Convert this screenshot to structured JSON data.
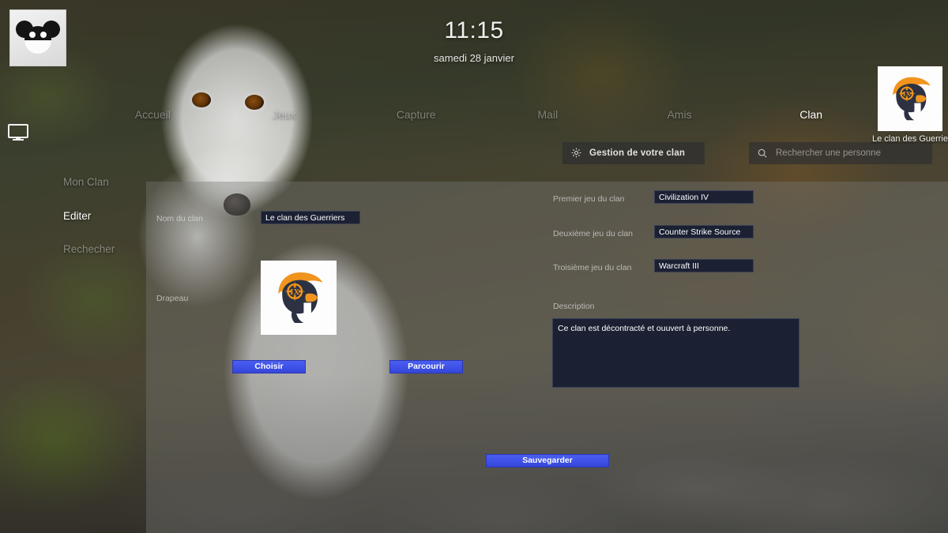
{
  "clock": {
    "time": "11:15",
    "date": "samedi 28 janvier"
  },
  "avatar": {
    "icon": "mouse-head-icon"
  },
  "rail": {
    "icon": "monitor-icon"
  },
  "topnav": {
    "items": [
      {
        "label": "Accueil",
        "active": false
      },
      {
        "label": "Jeux",
        "active": false
      },
      {
        "label": "Capture",
        "active": false
      },
      {
        "label": "Mail",
        "active": false
      },
      {
        "label": "Amis",
        "active": false
      },
      {
        "label": "Clan",
        "active": true
      }
    ]
  },
  "clan_badge": {
    "name": "Le clan des Guerriers",
    "icon": "spartan-helmet-icon"
  },
  "toolbar": {
    "manage_label": "Gestion de votre clan",
    "manage_icon": "gear-icon",
    "search_placeholder": "Rechercher une personne",
    "search_value": "",
    "search_icon": "search-icon"
  },
  "sidebar": {
    "items": [
      {
        "label": "Mon Clan",
        "active": false
      },
      {
        "label": "Editer",
        "active": true
      },
      {
        "label": "Rechecher",
        "active": false
      }
    ]
  },
  "form": {
    "clan_name_label": "Nom du clan",
    "clan_name_value": "Le clan des Guerriers",
    "flag_label": "Drapeau",
    "flag_icon": "spartan-helmet-icon",
    "choose_button": "Choisir",
    "browse_button": "Parcourir",
    "game1_label": "Premier jeu du clan",
    "game1_value": "Civilization IV",
    "game2_label": "Deuxième jeu du clan",
    "game2_value": "Counter Strike Source",
    "game3_label": "Troisième jeu du clan",
    "game3_value": "Warcraft III",
    "description_label": "Description",
    "description_value": "Ce clan est décontracté et ouuvert à personne.",
    "save_button": "Sauvegarder"
  },
  "colors": {
    "accent_blue": "#3f52e8",
    "field_bg": "#1b2133",
    "panel_overlay": "rgba(120,120,118,0.40)",
    "helmet_orange": "#f0941e",
    "helmet_navy": "#2c3242"
  }
}
